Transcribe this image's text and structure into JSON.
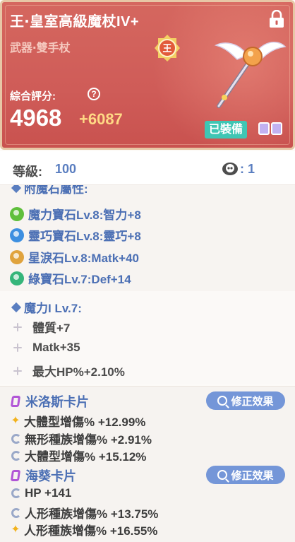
{
  "item": {
    "name": "王‧皇室高級魔杖IV+",
    "type": "武器‧雙手杖",
    "rank_badge": "王",
    "score_label": "綜合評分:",
    "score": "4968",
    "score_bonus": "+6087",
    "equipped_label": "已裝備",
    "lock_icon": "lock-icon",
    "help_icon": "?"
  },
  "stats": {
    "level_label": "等級:",
    "level_value": "100",
    "refine_value": ": 1"
  },
  "attached_gems": {
    "header": "附魔石屬性:",
    "items": [
      {
        "label": "魔力寶石Lv.8:智力+8",
        "color": "#5fbf3c"
      },
      {
        "label": "靈巧寶石Lv.8:靈巧+8",
        "color": "#3d8fe0"
      },
      {
        "label": "星淚石Lv.8:Matk+40",
        "color": "#e0a33d"
      },
      {
        "label": "綠寶石Lv.7:Def+14",
        "color": "#35b57a"
      }
    ]
  },
  "enchant": {
    "header": "魔力I Lv.7:",
    "items": [
      "體質+7",
      "Matk+35",
      "最大HP%+2.10%"
    ]
  },
  "cards": [
    {
      "name": "米洛斯卡片",
      "button": "修正效果",
      "effects": [
        "大體型增傷% +12.99%",
        "無形種族增傷% +2.91%",
        "大體型增傷% +15.12%"
      ]
    },
    {
      "name": "海葵卡片",
      "button": "修正效果",
      "effects": [
        "HP +141",
        "人形種族增傷% +13.75%",
        "人形種族增傷% +16.55%"
      ]
    }
  ],
  "colors": {
    "header_bg": "#cf5c58",
    "accent_blue": "#4b6fb4",
    "badge_teal": "#3fc6b4",
    "button_blue": "#7496d8",
    "score_bonus": "#ffd985"
  }
}
